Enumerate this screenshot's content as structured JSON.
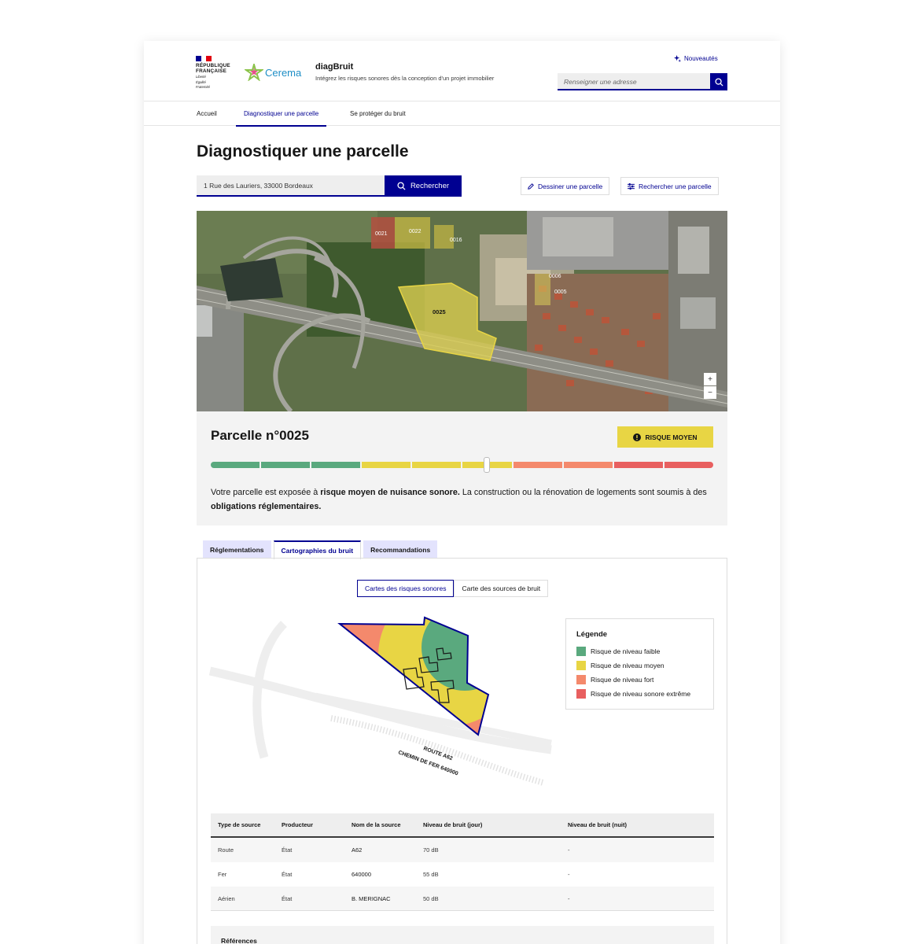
{
  "header": {
    "republique_line1": "RÉPUBLIQUE",
    "republique_line2": "FRANÇAISE",
    "devise_1": "Liberté",
    "devise_2": "Égalité",
    "devise_3": "Fraternité",
    "partner_logo": "Cerema",
    "app_title": "diagBruit",
    "tagline": "Intégrez les risques sonores dès la conception d'un projet immobilier",
    "news_link": "Nouveautés",
    "search_placeholder": "Renseigner une adresse"
  },
  "nav": [
    "Accueil",
    "Diagnostiquer une parcelle",
    "Se protéger du bruit"
  ],
  "page_title": "Diagnostiquer une parcelle",
  "address_search": {
    "value": "1 Rue des Lauriers, 33000 Bordeaux",
    "button": "Rechercher"
  },
  "actions": {
    "draw": "Dessiner une parcelle",
    "search": "Rechercher une parcelle"
  },
  "map": {
    "parcel_labels": [
      "0021",
      "0022",
      "0016",
      "0025",
      "0006",
      "0005"
    ],
    "zoom_in": "+",
    "zoom_out": "−"
  },
  "parcel": {
    "title": "Parcelle n°0025",
    "risk_badge": "RISQUE MOYEN",
    "risk_level": 0.55,
    "text_1": "Votre parcelle est exposée à ",
    "text_bold_1": "risque moyen de nuisance sonore.",
    "text_2": " La construction ou la rénovation de logements sont soumis à des ",
    "text_bold_2": "obligations réglementaires."
  },
  "tabs": [
    "Réglementations",
    "Cartographies du bruit",
    "Recommandations"
  ],
  "active_tab": 1,
  "map_toggle": [
    "Cartes des risques sonores",
    "Carte des sources de bruit"
  ],
  "diagram": {
    "road_label": "ROUTE A62",
    "rail_label": "CHEMIN DE FER 640000"
  },
  "legend": {
    "title": "Légende",
    "items": [
      {
        "label": "Risque de niveau faible",
        "color": "#5aa97e"
      },
      {
        "label": "Risque de niveau moyen",
        "color": "#e8d544"
      },
      {
        "label": "Risque de niveau fort",
        "color": "#f4896c"
      },
      {
        "label": "Risque de niveau sonore extrême",
        "color": "#e85f5f"
      }
    ]
  },
  "table": {
    "headers": [
      "Type de source",
      "Producteur",
      "Nom de la source",
      "Niveau de bruit (jour)",
      "Niveau de bruit (nuit)"
    ],
    "rows": [
      [
        "Route",
        "État",
        "A62",
        "70 dB",
        "-"
      ],
      [
        "Fer",
        "État",
        "640000",
        "55 dB",
        "-"
      ],
      [
        "Aérien",
        "État",
        "B. MERIGNAC",
        "50 dB",
        "-"
      ]
    ]
  },
  "references_title": "Références",
  "colors": {
    "primary": "#000091",
    "risk_medium": "#e8d544",
    "green": "#5aa97e",
    "orange": "#f4896c",
    "red": "#e85f5f"
  }
}
